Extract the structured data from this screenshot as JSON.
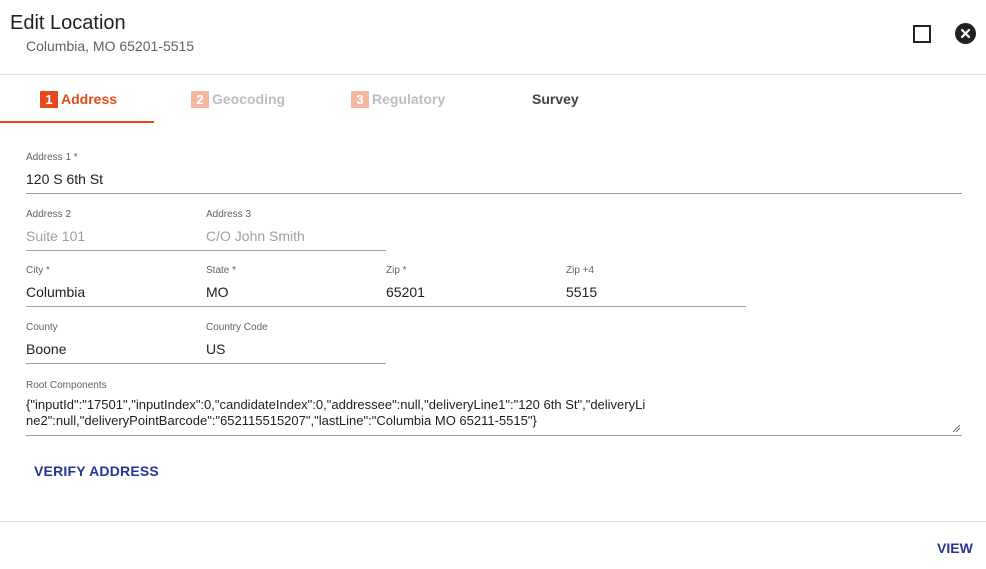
{
  "dialog": {
    "title": "Edit Location",
    "subtitle": "Columbia, MO 65201-5515"
  },
  "tabs": [
    {
      "number": "1",
      "label": "Address",
      "state": "active"
    },
    {
      "number": "2",
      "label": "Geocoding",
      "state": "disabled"
    },
    {
      "number": "3",
      "label": "Regulatory",
      "state": "disabled"
    },
    {
      "label": "Survey",
      "state": "enabled"
    }
  ],
  "form": {
    "address1": {
      "label": "Address 1 *",
      "value": "120 S 6th St"
    },
    "address2": {
      "label": "Address 2",
      "placeholder": "Suite 101"
    },
    "address3": {
      "label": "Address 3",
      "placeholder": "C/O John Smith"
    },
    "city": {
      "label": "City *",
      "value": "Columbia"
    },
    "state": {
      "label": "State *",
      "value": "MO"
    },
    "zip": {
      "label": "Zip *",
      "value": "65201"
    },
    "zip4": {
      "label": "Zip +4",
      "value": "5515"
    },
    "county": {
      "label": "County",
      "value": "Boone"
    },
    "country_code": {
      "label": "Country Code",
      "value": "US"
    },
    "root_components": {
      "label": "Root Components",
      "value": "{\"inputId\":\"17501\",\"inputIndex\":0,\"candidateIndex\":0,\"addressee\":null,\"deliveryLine1\":\"120 6th St\",\"deliveryLine2\":null,\"deliveryPointBarcode\":\"652115515207\",\"lastLine\":\"Columbia MO 65211-5515\"}"
    }
  },
  "actions": {
    "verify_label": "VERIFY ADDRESS",
    "view_label": "VIEW"
  },
  "colors": {
    "accent": "#e64a19",
    "button_text": "#283593"
  },
  "icons": {
    "maximize": "square-outline-icon",
    "close": "close-circle-icon"
  }
}
